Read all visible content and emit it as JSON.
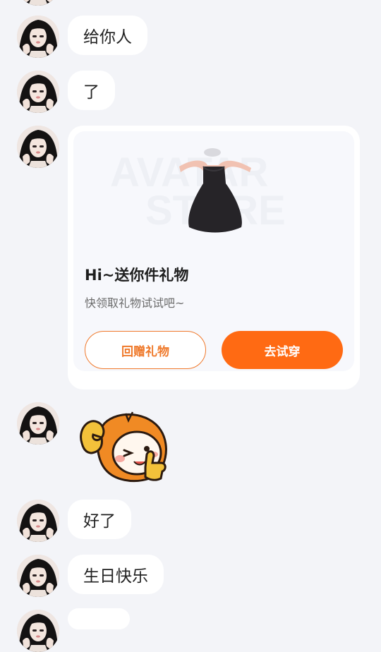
{
  "messages": [
    {
      "kind": "text",
      "text": "给你人"
    },
    {
      "kind": "text",
      "text": "了"
    },
    {
      "kind": "gift_card",
      "banner_text": "AVATAR STORE",
      "title": "Hi~送你件礼物",
      "subtitle": "快领取礼物试试吧~",
      "return_gift_label": "回赠礼物",
      "try_on_label": "去试穿"
    },
    {
      "kind": "sticker",
      "icon": "thumbs-up-mascot-icon"
    },
    {
      "kind": "text",
      "text": "好了"
    },
    {
      "kind": "text",
      "text": "生日快乐"
    }
  ],
  "colors": {
    "background": "#f3f4f8",
    "bubble": "#ffffff",
    "accent": "#ff6a13",
    "accent_outline": "#f0782a"
  }
}
